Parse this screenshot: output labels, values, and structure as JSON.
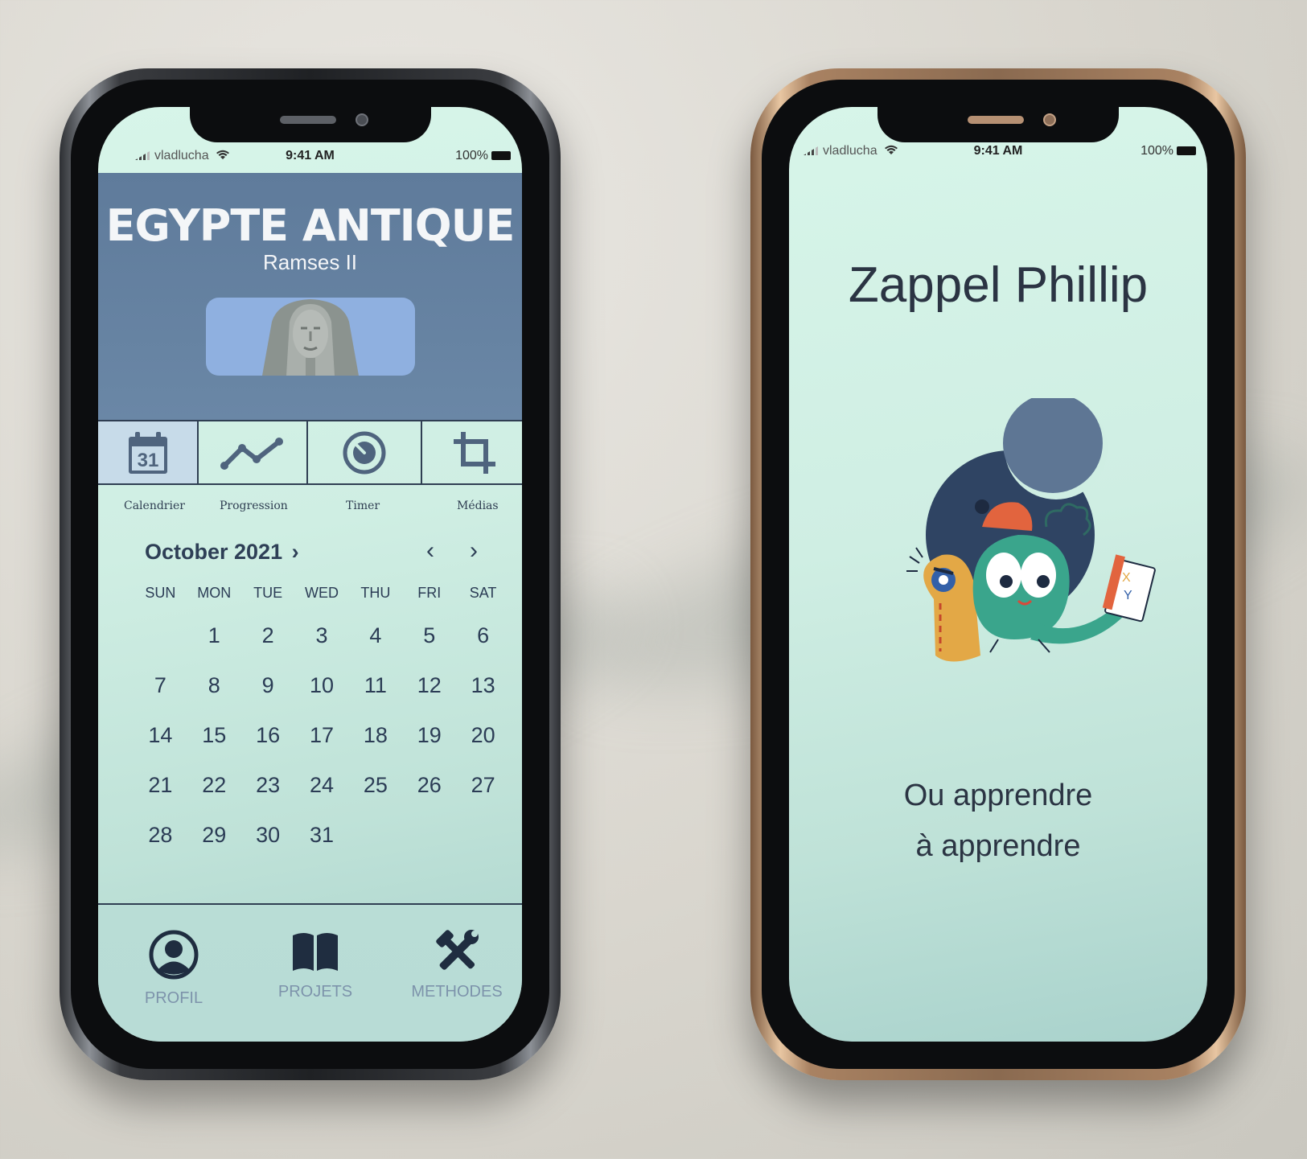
{
  "status_bar": {
    "carrier": "vladlucha",
    "time": "9:41 AM",
    "battery": "100%"
  },
  "left_app": {
    "hero": {
      "title": "EGYPTE ANTIQUE",
      "subtitle": "Ramses II"
    },
    "tools": [
      {
        "label": "Calendrier",
        "icon": "calendar-icon",
        "icon_text": "31",
        "active": true
      },
      {
        "label": "Progression",
        "icon": "progression-icon",
        "active": false
      },
      {
        "label": "Timer",
        "icon": "timer-icon",
        "active": false
      },
      {
        "label": "Médias",
        "icon": "crop-icon",
        "active": false
      }
    ],
    "calendar": {
      "month_label": "October 2021",
      "weekdays": [
        "SUN",
        "MON",
        "TUE",
        "WED",
        "THU",
        "FRI",
        "SAT"
      ],
      "weeks": [
        [
          "",
          "1",
          "2",
          "3",
          "4",
          "5",
          "6"
        ],
        [
          "7",
          "8",
          "9",
          "10",
          "11",
          "12",
          "13"
        ],
        [
          "14",
          "15",
          "16",
          "17",
          "18",
          "19",
          "20"
        ],
        [
          "21",
          "22",
          "23",
          "24",
          "25",
          "26",
          "27"
        ],
        [
          "28",
          "29",
          "30",
          "31",
          "",
          "",
          ""
        ]
      ]
    },
    "bottom_nav": [
      {
        "label": "PROFIL",
        "icon": "profile-icon"
      },
      {
        "label": "PROJETS",
        "icon": "book-icon"
      },
      {
        "label": "METHODES",
        "icon": "tools-icon"
      }
    ],
    "colors": {
      "hero": "#6a87a6",
      "ink": "#2e3f56",
      "nav_label": "#7d93ab"
    }
  },
  "right_app": {
    "title": "Zappel Phillip",
    "tagline_line1": "Ou apprendre",
    "tagline_line2": "à apprendre",
    "colors": {
      "title": "#2b3443",
      "background": "#cfeee3"
    }
  }
}
